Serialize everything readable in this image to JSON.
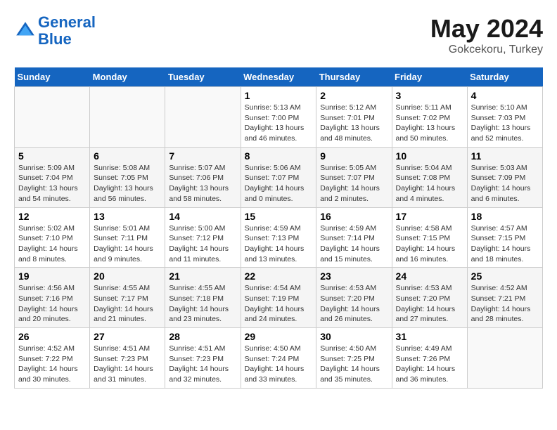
{
  "header": {
    "logo_line1": "General",
    "logo_line2": "Blue",
    "month": "May 2024",
    "location": "Gokcekoru, Turkey"
  },
  "weekdays": [
    "Sunday",
    "Monday",
    "Tuesday",
    "Wednesday",
    "Thursday",
    "Friday",
    "Saturday"
  ],
  "weeks": [
    [
      {
        "day": "",
        "info": ""
      },
      {
        "day": "",
        "info": ""
      },
      {
        "day": "",
        "info": ""
      },
      {
        "day": "1",
        "info": "Sunrise: 5:13 AM\nSunset: 7:00 PM\nDaylight: 13 hours\nand 46 minutes."
      },
      {
        "day": "2",
        "info": "Sunrise: 5:12 AM\nSunset: 7:01 PM\nDaylight: 13 hours\nand 48 minutes."
      },
      {
        "day": "3",
        "info": "Sunrise: 5:11 AM\nSunset: 7:02 PM\nDaylight: 13 hours\nand 50 minutes."
      },
      {
        "day": "4",
        "info": "Sunrise: 5:10 AM\nSunset: 7:03 PM\nDaylight: 13 hours\nand 52 minutes."
      }
    ],
    [
      {
        "day": "5",
        "info": "Sunrise: 5:09 AM\nSunset: 7:04 PM\nDaylight: 13 hours\nand 54 minutes."
      },
      {
        "day": "6",
        "info": "Sunrise: 5:08 AM\nSunset: 7:05 PM\nDaylight: 13 hours\nand 56 minutes."
      },
      {
        "day": "7",
        "info": "Sunrise: 5:07 AM\nSunset: 7:06 PM\nDaylight: 13 hours\nand 58 minutes."
      },
      {
        "day": "8",
        "info": "Sunrise: 5:06 AM\nSunset: 7:07 PM\nDaylight: 14 hours\nand 0 minutes."
      },
      {
        "day": "9",
        "info": "Sunrise: 5:05 AM\nSunset: 7:07 PM\nDaylight: 14 hours\nand 2 minutes."
      },
      {
        "day": "10",
        "info": "Sunrise: 5:04 AM\nSunset: 7:08 PM\nDaylight: 14 hours\nand 4 minutes."
      },
      {
        "day": "11",
        "info": "Sunrise: 5:03 AM\nSunset: 7:09 PM\nDaylight: 14 hours\nand 6 minutes."
      }
    ],
    [
      {
        "day": "12",
        "info": "Sunrise: 5:02 AM\nSunset: 7:10 PM\nDaylight: 14 hours\nand 8 minutes."
      },
      {
        "day": "13",
        "info": "Sunrise: 5:01 AM\nSunset: 7:11 PM\nDaylight: 14 hours\nand 9 minutes."
      },
      {
        "day": "14",
        "info": "Sunrise: 5:00 AM\nSunset: 7:12 PM\nDaylight: 14 hours\nand 11 minutes."
      },
      {
        "day": "15",
        "info": "Sunrise: 4:59 AM\nSunset: 7:13 PM\nDaylight: 14 hours\nand 13 minutes."
      },
      {
        "day": "16",
        "info": "Sunrise: 4:59 AM\nSunset: 7:14 PM\nDaylight: 14 hours\nand 15 minutes."
      },
      {
        "day": "17",
        "info": "Sunrise: 4:58 AM\nSunset: 7:15 PM\nDaylight: 14 hours\nand 16 minutes."
      },
      {
        "day": "18",
        "info": "Sunrise: 4:57 AM\nSunset: 7:15 PM\nDaylight: 14 hours\nand 18 minutes."
      }
    ],
    [
      {
        "day": "19",
        "info": "Sunrise: 4:56 AM\nSunset: 7:16 PM\nDaylight: 14 hours\nand 20 minutes."
      },
      {
        "day": "20",
        "info": "Sunrise: 4:55 AM\nSunset: 7:17 PM\nDaylight: 14 hours\nand 21 minutes."
      },
      {
        "day": "21",
        "info": "Sunrise: 4:55 AM\nSunset: 7:18 PM\nDaylight: 14 hours\nand 23 minutes."
      },
      {
        "day": "22",
        "info": "Sunrise: 4:54 AM\nSunset: 7:19 PM\nDaylight: 14 hours\nand 24 minutes."
      },
      {
        "day": "23",
        "info": "Sunrise: 4:53 AM\nSunset: 7:20 PM\nDaylight: 14 hours\nand 26 minutes."
      },
      {
        "day": "24",
        "info": "Sunrise: 4:53 AM\nSunset: 7:20 PM\nDaylight: 14 hours\nand 27 minutes."
      },
      {
        "day": "25",
        "info": "Sunrise: 4:52 AM\nSunset: 7:21 PM\nDaylight: 14 hours\nand 28 minutes."
      }
    ],
    [
      {
        "day": "26",
        "info": "Sunrise: 4:52 AM\nSunset: 7:22 PM\nDaylight: 14 hours\nand 30 minutes."
      },
      {
        "day": "27",
        "info": "Sunrise: 4:51 AM\nSunset: 7:23 PM\nDaylight: 14 hours\nand 31 minutes."
      },
      {
        "day": "28",
        "info": "Sunrise: 4:51 AM\nSunset: 7:23 PM\nDaylight: 14 hours\nand 32 minutes."
      },
      {
        "day": "29",
        "info": "Sunrise: 4:50 AM\nSunset: 7:24 PM\nDaylight: 14 hours\nand 33 minutes."
      },
      {
        "day": "30",
        "info": "Sunrise: 4:50 AM\nSunset: 7:25 PM\nDaylight: 14 hours\nand 35 minutes."
      },
      {
        "day": "31",
        "info": "Sunrise: 4:49 AM\nSunset: 7:26 PM\nDaylight: 14 hours\nand 36 minutes."
      },
      {
        "day": "",
        "info": ""
      }
    ]
  ]
}
